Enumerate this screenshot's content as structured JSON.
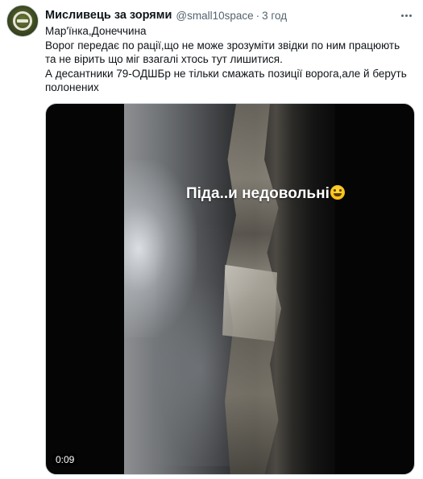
{
  "tweet": {
    "author_name": "Мисливець за зорями",
    "handle": "@small10space",
    "separator": "·",
    "time": "3 год",
    "text_lines": [
      "Мар'їнка,Донеччина",
      "Ворог передає по рації,що не може зрозуміти звідки по ним працюють та не вірить що міг взагалі хтось тут лишитися.",
      "А десантники 79-ОДШБр не тільки смажать позиції ворога,але й беруть полонених"
    ],
    "media": {
      "type": "video",
      "overlay_caption": "Піда..и недовольні",
      "overlay_emoji": "rolling-on-floor-laughing-icon",
      "duration": "0:09"
    }
  },
  "icons": {
    "avatar": "avatar-emblem-icon",
    "more": "more-options-icon"
  },
  "colors": {
    "text_primary": "#0f1419",
    "text_secondary": "#536471",
    "border": "#cfd9de"
  }
}
